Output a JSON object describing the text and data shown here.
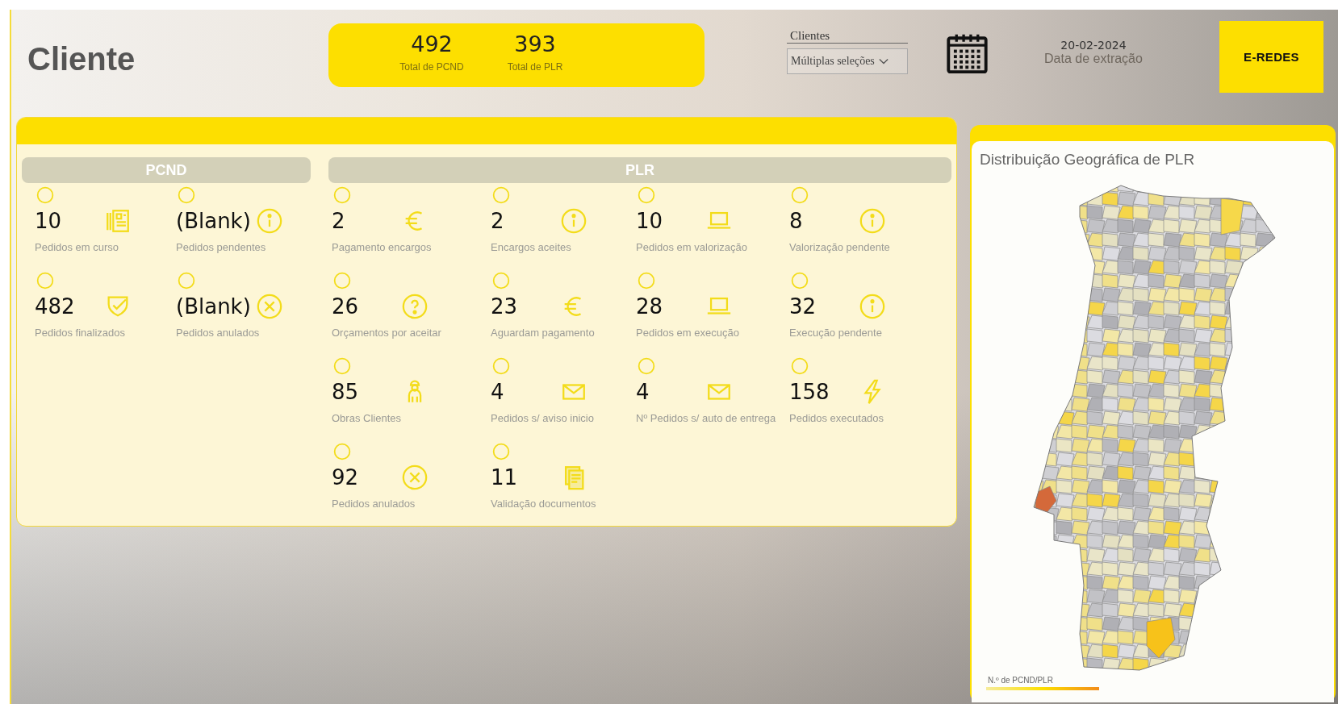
{
  "title": "Cliente",
  "totals": [
    {
      "value": "492",
      "label": "Total de PCND"
    },
    {
      "value": "393",
      "label": "Total de PLR"
    }
  ],
  "filter": {
    "label": "Clientes",
    "value": "Múltiplas seleções"
  },
  "extraction": {
    "date": "20-02-2024",
    "label": "Data de extração"
  },
  "logo": "E-REDES",
  "sections": [
    {
      "title": "PCND",
      "tiles": [
        {
          "value": "10",
          "label": "Pedidos em curso",
          "kind": "document"
        },
        {
          "value": "(Blank)",
          "label": "Pedidos pendentes",
          "kind": "info"
        },
        {
          "value": "482",
          "label": "Pedidos finalizados",
          "kind": "shield-check"
        },
        {
          "value": "(Blank)",
          "label": "Pedidos anulados",
          "kind": "cancel"
        }
      ]
    },
    {
      "title": "PLR",
      "tiles": [
        {
          "value": "2",
          "label": "Pagamento encargos",
          "kind": "euro"
        },
        {
          "value": "2",
          "label": "Encargos aceites",
          "kind": "info"
        },
        {
          "value": "10",
          "label": "Pedidos em valorização",
          "kind": "laptop"
        },
        {
          "value": "8",
          "label": "Valorização pendente",
          "kind": "info"
        },
        {
          "value": "26",
          "label": "Orçamentos por aceitar",
          "kind": "question"
        },
        {
          "value": "23",
          "label": "Aguardam pagamento",
          "kind": "euro"
        },
        {
          "value": "28",
          "label": "Pedidos em execução",
          "kind": "laptop"
        },
        {
          "value": "32",
          "label": "Execução pendente",
          "kind": "info"
        },
        {
          "value": "85",
          "label": "Obras Clientes",
          "kind": "worker"
        },
        {
          "value": "4",
          "label": "Pedidos s/ aviso inicio",
          "kind": "envelope"
        },
        {
          "value": "4",
          "label": "Nº Pedidos s/ auto de entrega",
          "kind": "envelope"
        },
        {
          "value": "158",
          "label": "Pedidos executados",
          "kind": "lightning"
        },
        {
          "value": "92",
          "label": "Pedidos anulados",
          "kind": "cancel"
        },
        {
          "value": "11",
          "label": "Validação documentos",
          "kind": "documents"
        }
      ]
    }
  ],
  "map": {
    "title": "Distribuição Geográfica de PLR",
    "legend_title": "N.º de PCND/PLR"
  }
}
